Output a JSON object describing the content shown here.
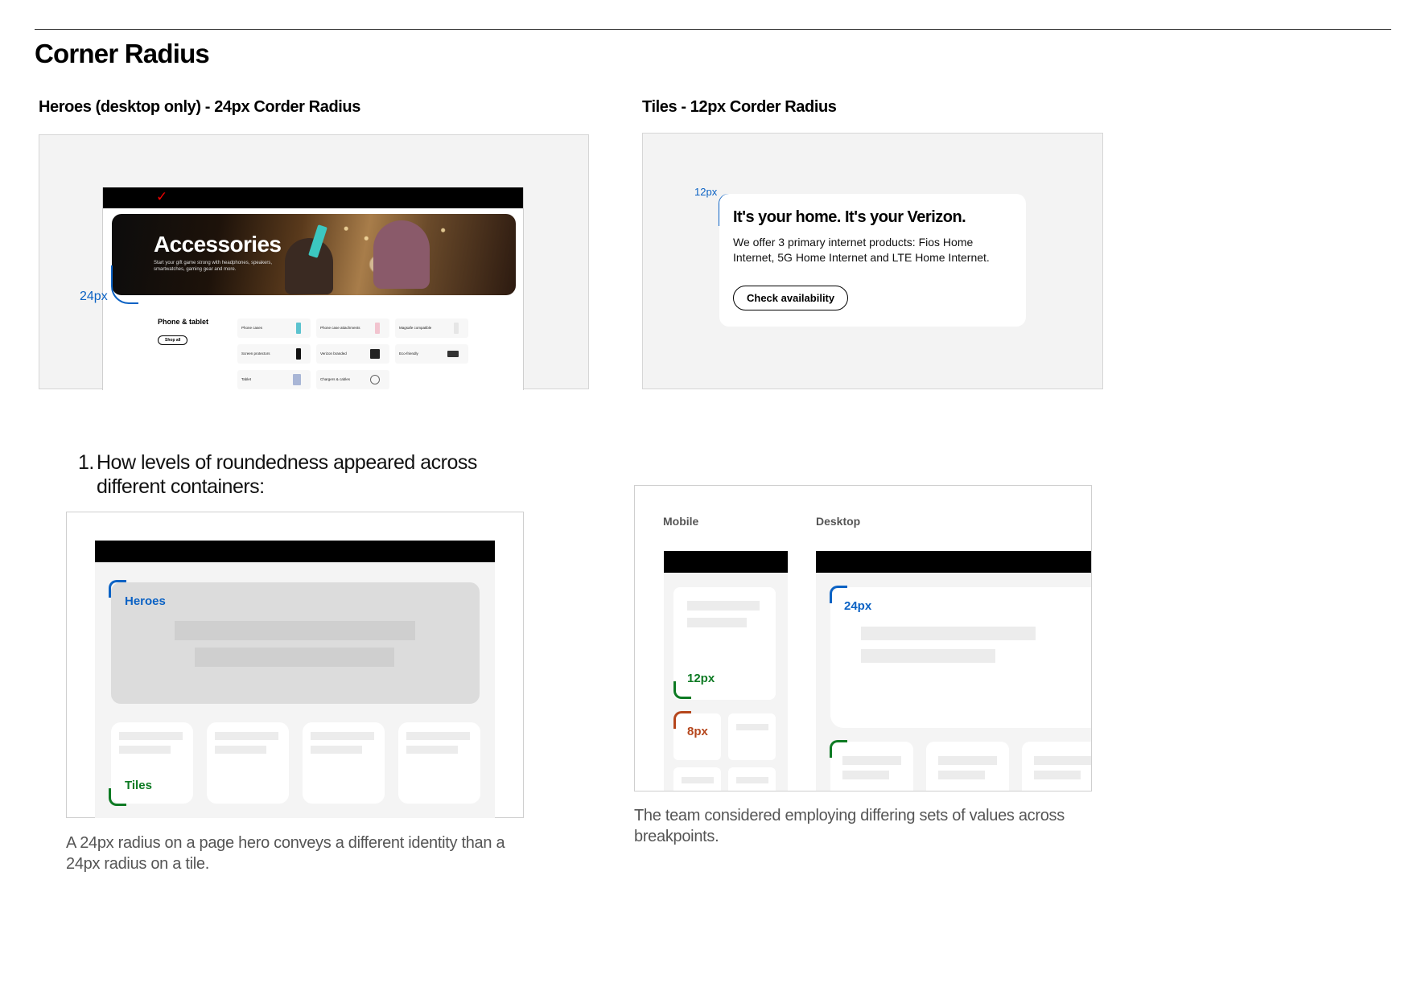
{
  "page": {
    "title": "Corner Radius"
  },
  "heroes_section": {
    "title": "Heroes (desktop only) - 24px Corder Radius",
    "radius_label": "24px",
    "hero": {
      "title": "Accessories",
      "subtitle": "Start your gift game strong with headphones, speakers, smartwatches, gaming gear and more."
    },
    "category": {
      "title": "Phone & tablet",
      "shop_all": "Shop all"
    },
    "products": [
      "Phone cases",
      "Phone case attachments",
      "Magsafe compatible",
      "Screen protectors",
      "Verizon branded",
      "Eco-friendly",
      "Tablet",
      "Chargers & cables"
    ]
  },
  "tiles_section": {
    "title": "Tiles - 12px Corder Radius",
    "radius_label": "12px",
    "card": {
      "title": "It's your home. It's your Verizon.",
      "body": "We offer 3 primary internet products: Fios Home Internet, 5G Home Internet and LTE Home Internet.",
      "button": "Check availability"
    }
  },
  "finding_1": {
    "number": "1.",
    "text": "How levels of roundedness appeared across different containers:",
    "labels": {
      "heroes": "Heroes",
      "tiles": "Tiles"
    },
    "caption": "A 24px radius on a page hero conveys a different identity than a 24px radius on a tile."
  },
  "breakpoints": {
    "mobile_label": "Mobile",
    "desktop_label": "Desktop",
    "mobile_tile_radius": "12px",
    "mobile_small_radius": "8px",
    "desktop_radius": "24px",
    "caption": "The team considered employing differing sets of values across breakpoints."
  },
  "colors": {
    "blue": "#0b62c4",
    "green": "#0d7a23",
    "rust": "#b5461c",
    "brand_red": "#e00000"
  }
}
